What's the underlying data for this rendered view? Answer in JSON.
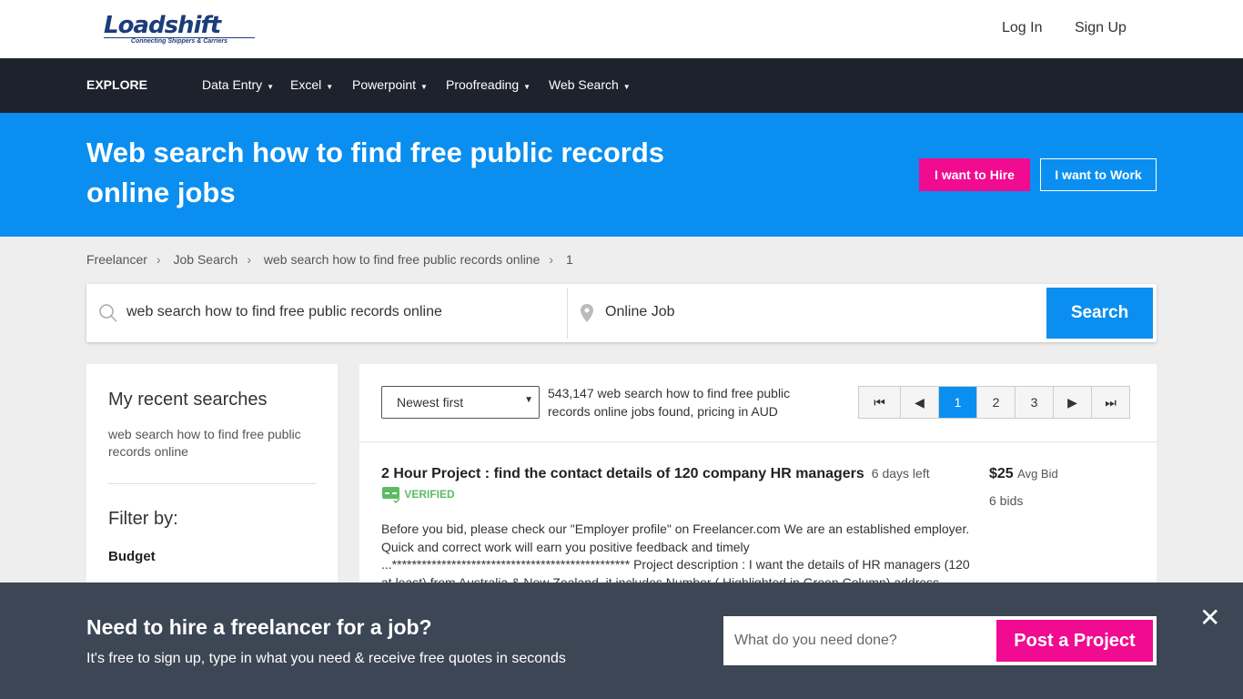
{
  "header": {
    "logo_text": "Loadshift",
    "logo_tagline": "Connecting Shippers & Carriers",
    "login": "Log In",
    "signup": "Sign Up"
  },
  "nav": {
    "explore": "EXPLORE",
    "items": [
      "Data Entry",
      "Excel",
      "Powerpoint",
      "Proofreading",
      "Web Search"
    ]
  },
  "hero": {
    "title": "Web search how to find free public records online jobs",
    "hire": "I want to Hire",
    "work": "I want to Work"
  },
  "breadcrumb": [
    "Freelancer",
    "Job Search",
    "web search how to find free public records online",
    "1"
  ],
  "search": {
    "query": "web search how to find free public records online",
    "location": "Online Job",
    "button": "Search"
  },
  "sidebar": {
    "recent_title": "My recent searches",
    "recent_item": "web search how to find free public records online",
    "filter_title": "Filter by:",
    "budget": "Budget"
  },
  "results": {
    "sort": "Newest first",
    "count": "543,147 web search how to find free public records online jobs found, pricing in AUD",
    "pages": [
      "1",
      "2",
      "3"
    ],
    "current_page": 1
  },
  "project": {
    "title": "2 Hour Project : find the contact details of 120 company HR managers",
    "time_left": "6 days left",
    "verified": "VERIFIED",
    "price": "$25",
    "price_label": "Avg Bid",
    "bids": "6 bids",
    "description": "Before you bid, please check our \"Employer profile\" on Freelancer.com We are an established employer. Quick and correct work will earn you positive feedback and timely ...************************************************ Project description : I want the details of HR managers (120 at least) from Australia & New Zealand, it includes Number ( Highlighted in Green Column) address"
  },
  "footer": {
    "title": "Need to hire a freelancer for a job?",
    "subtitle": "It's free to sign up, type in what you need & receive free quotes in seconds",
    "placeholder": "What do you need done?",
    "post": "Post a Project"
  },
  "colors": {
    "accent": "#0a8ff0",
    "pink": "#f00b90",
    "nav": "#1e222d",
    "footer": "#3c4654",
    "verified": "#5dbb63"
  }
}
